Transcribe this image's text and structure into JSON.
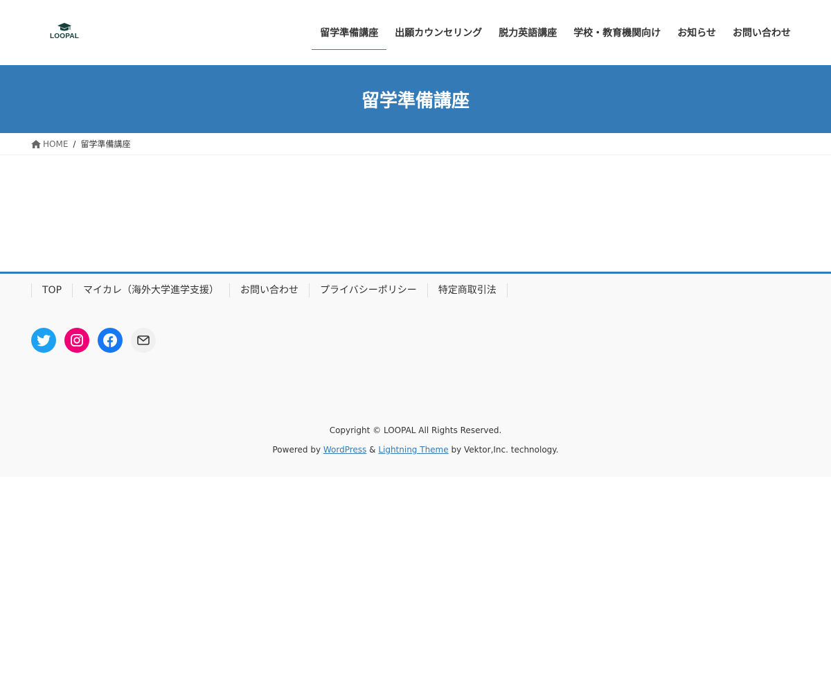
{
  "header": {
    "logo_text": "LOOPAL",
    "nav": [
      {
        "label": "留学準備講座",
        "active": true
      },
      {
        "label": "出願カウンセリング"
      },
      {
        "label": "脱力英語講座"
      },
      {
        "label": "学校・教育機関向け"
      },
      {
        "label": "お知らせ"
      },
      {
        "label": "お問い合わせ"
      }
    ]
  },
  "page_header": {
    "title": "留学準備講座"
  },
  "breadcrumb": {
    "home_label": "HOME",
    "separator": "/",
    "current": "留学準備講座"
  },
  "footer": {
    "nav": [
      {
        "label": "TOP"
      },
      {
        "label": "マイカレ（海外大学進学支援）"
      },
      {
        "label": "お問い合わせ"
      },
      {
        "label": "プライバシーポリシー"
      },
      {
        "label": "特定商取引法"
      }
    ],
    "social": [
      "twitter-icon",
      "instagram-icon",
      "facebook-icon",
      "mail-icon"
    ],
    "copyright": "Copyright © LOOPAL All Rights Reserved.",
    "powered_prefix": "Powered by ",
    "powered_wp": "WordPress",
    "powered_amp": " & ",
    "powered_theme": "Lightning Theme",
    "powered_suffix": " by Vektor,Inc. technology."
  },
  "colors": {
    "accent": "#337ab7",
    "twitter": "#1da1f2",
    "instagram": "#f00075",
    "facebook": "#1877f2"
  }
}
